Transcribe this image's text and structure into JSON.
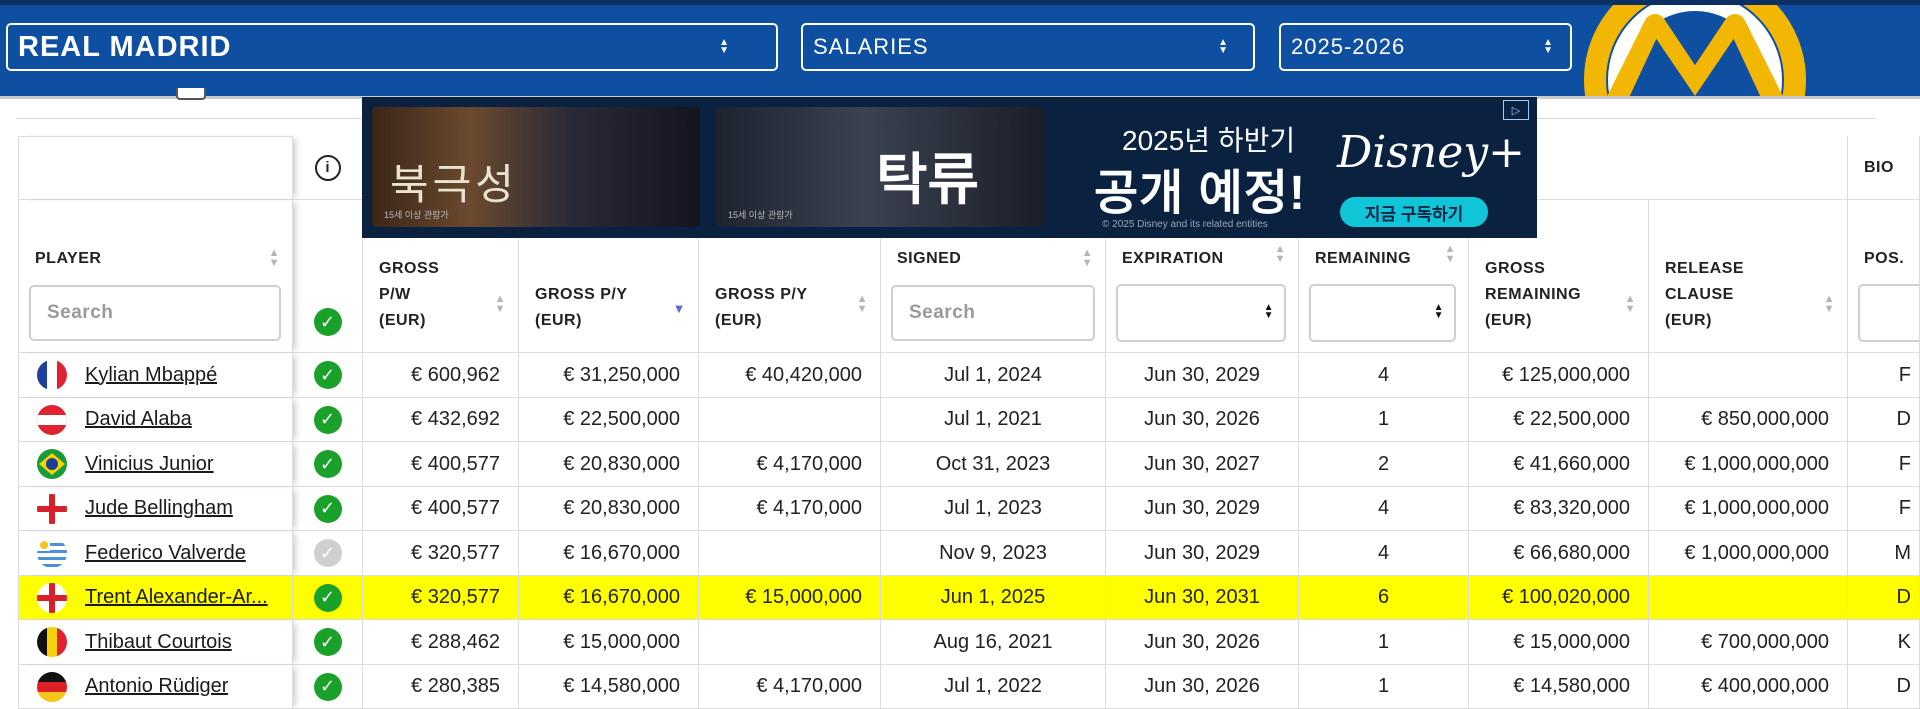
{
  "header": {
    "team_select": "REAL MADRID",
    "category_select": "SALARIES",
    "season_select": "2025-2026"
  },
  "ad": {
    "title_left": "북극성",
    "title_right": "탁류",
    "rating_left": "15세 이상 관람가",
    "rating_right": "15세 이상 관람가",
    "line1": "2025년 하반기",
    "line2": "공개 예정!",
    "copyright": "© 2025 Disney and its related entities",
    "brand": "Disney+",
    "cta": "지금 구독하기"
  },
  "table": {
    "info_icon_label": "i",
    "group_bio": "BIO",
    "columns": {
      "player": "PLAYER",
      "gross_pw_1": "GROSS",
      "gross_pw_2": "P/W",
      "gross_pw_3": "(EUR)",
      "gross_py_1": "GROSS P/Y",
      "gross_py_2": "(EUR)",
      "gross_py2_1": "GROSS P/Y",
      "gross_py2_2": "(EUR)",
      "signed": "SIGNED",
      "expiration": "EXPIRATION",
      "remaining": "REMAINING",
      "gross_rem_1": "GROSS",
      "gross_rem_2": "REMAINING",
      "gross_rem_3": "(EUR)",
      "release_1": "RELEASE",
      "release_2": "CLAUSE",
      "release_3": "(EUR)",
      "pos": "POS."
    },
    "player_search_placeholder": "Search",
    "signed_search_placeholder": "Search",
    "rows": [
      {
        "flag": "france",
        "player": "Kylian Mbappé",
        "active": true,
        "gross_pw": "€ 600,962",
        "gross_py": "€ 31,250,000",
        "gross_py2": "€ 40,420,000",
        "signed": "Jul 1, 2024",
        "expiration": "Jun 30, 2029",
        "remaining": "4",
        "gross_remaining": "€ 125,000,000",
        "release": "",
        "pos": "F"
      },
      {
        "flag": "austria",
        "player": "David Alaba",
        "active": true,
        "gross_pw": "€ 432,692",
        "gross_py": "€ 22,500,000",
        "gross_py2": "",
        "signed": "Jul 1, 2021",
        "expiration": "Jun 30, 2026",
        "remaining": "1",
        "gross_remaining": "€ 22,500,000",
        "release": "€ 850,000,000",
        "pos": "D"
      },
      {
        "flag": "brazil",
        "player": "Vinicius Junior",
        "active": true,
        "gross_pw": "€ 400,577",
        "gross_py": "€ 20,830,000",
        "gross_py2": "€ 4,170,000",
        "signed": "Oct 31, 2023",
        "expiration": "Jun 30, 2027",
        "remaining": "2",
        "gross_remaining": "€ 41,660,000",
        "release": "€ 1,000,000,000",
        "pos": "F"
      },
      {
        "flag": "england",
        "player": "Jude Bellingham",
        "active": true,
        "gross_pw": "€ 400,577",
        "gross_py": "€ 20,830,000",
        "gross_py2": "€ 4,170,000",
        "signed": "Jul 1, 2023",
        "expiration": "Jun 30, 2029",
        "remaining": "4",
        "gross_remaining": "€ 83,320,000",
        "release": "€ 1,000,000,000",
        "pos": "F"
      },
      {
        "flag": "uruguay",
        "player": "Federico Valverde",
        "active": false,
        "gross_pw": "€ 320,577",
        "gross_py": "€ 16,670,000",
        "gross_py2": "",
        "signed": "Nov 9, 2023",
        "expiration": "Jun 30, 2029",
        "remaining": "4",
        "gross_remaining": "€ 66,680,000",
        "release": "€ 1,000,000,000",
        "pos": "M"
      },
      {
        "flag": "england",
        "player": "Trent Alexander-Ar...",
        "active": true,
        "highlight": true,
        "gross_pw": "€ 320,577",
        "gross_py": "€ 16,670,000",
        "gross_py2": "€ 15,000,000",
        "signed": "Jun 1, 2025",
        "expiration": "Jun 30, 2031",
        "remaining": "6",
        "gross_remaining": "€ 100,020,000",
        "release": "",
        "pos": "D"
      },
      {
        "flag": "belgium",
        "player": "Thibaut Courtois",
        "active": true,
        "gross_pw": "€ 288,462",
        "gross_py": "€ 15,000,000",
        "gross_py2": "",
        "signed": "Aug 16, 2021",
        "expiration": "Jun 30, 2026",
        "remaining": "1",
        "gross_remaining": "€ 15,000,000",
        "release": "€ 700,000,000",
        "pos": "K"
      },
      {
        "flag": "germany",
        "player": "Antonio Rüdiger",
        "active": true,
        "gross_pw": "€ 280,385",
        "gross_py": "€ 14,580,000",
        "gross_py2": "€ 4,170,000",
        "signed": "Jul 1, 2022",
        "expiration": "Jun 30, 2026",
        "remaining": "1",
        "gross_remaining": "€ 14,580,000",
        "release": "€ 400,000,000",
        "pos": "D"
      }
    ]
  }
}
